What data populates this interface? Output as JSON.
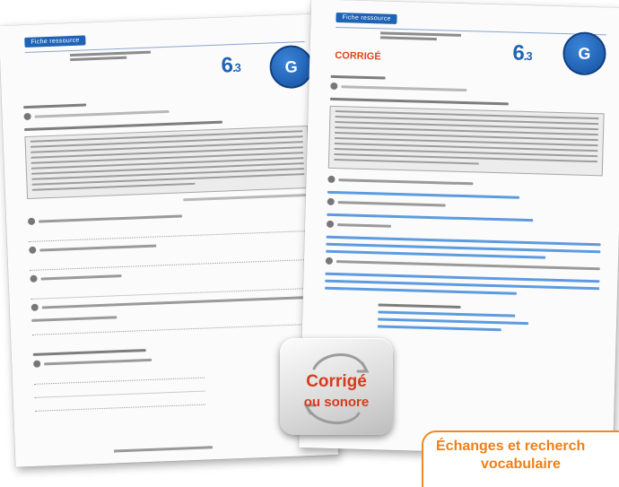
{
  "left_sheet": {
    "header_tag": "Fiche ressource",
    "code_main": "6",
    "code_sub": ".3",
    "badge": "G"
  },
  "right_sheet": {
    "header_tag": "Fiche ressource",
    "code_main": "6",
    "code_sub": ".3",
    "badge": "G",
    "corrige_stamp": "CORRIGÉ"
  },
  "corrige_button": {
    "line1": "Corrigé",
    "line2": "ou sonore",
    "accent": "#d63a1c"
  },
  "echanges_label": {
    "line1": "Échanges et recherch",
    "line2": "vocabulaire",
    "accent": "#ef7f16"
  }
}
